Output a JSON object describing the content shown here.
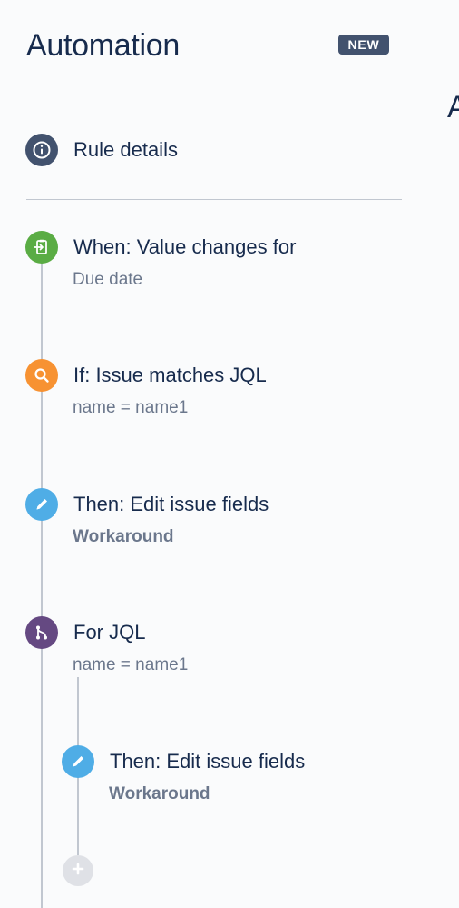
{
  "header": {
    "title": "Automation",
    "badge": "NEW",
    "edge_letter": "A"
  },
  "rule_details": {
    "label": "Rule details",
    "icon": "info-icon"
  },
  "colors": {
    "trigger": "#5aac44",
    "condition": "#f79232",
    "action": "#4fade6",
    "branch": "#654982",
    "info": "#42526e",
    "add": "#dfe1e6"
  },
  "steps": [
    {
      "type": "trigger",
      "icon": "trigger-icon",
      "title": "When: Value changes for",
      "subtitle": "Due date"
    },
    {
      "type": "condition",
      "icon": "search-icon",
      "title": "If: Issue matches JQL",
      "subtitle": "name = name1"
    },
    {
      "type": "action",
      "icon": "pencil-icon",
      "title": "Then: Edit issue fields",
      "subtitle": "Workaround"
    },
    {
      "type": "branch",
      "icon": "branch-icon",
      "title": "For JQL",
      "subtitle": "name = name1"
    },
    {
      "type": "action",
      "icon": "pencil-icon",
      "title": "Then: Edit issue fields",
      "subtitle": "Workaround"
    }
  ],
  "add_component": {
    "icon": "plus-icon"
  }
}
